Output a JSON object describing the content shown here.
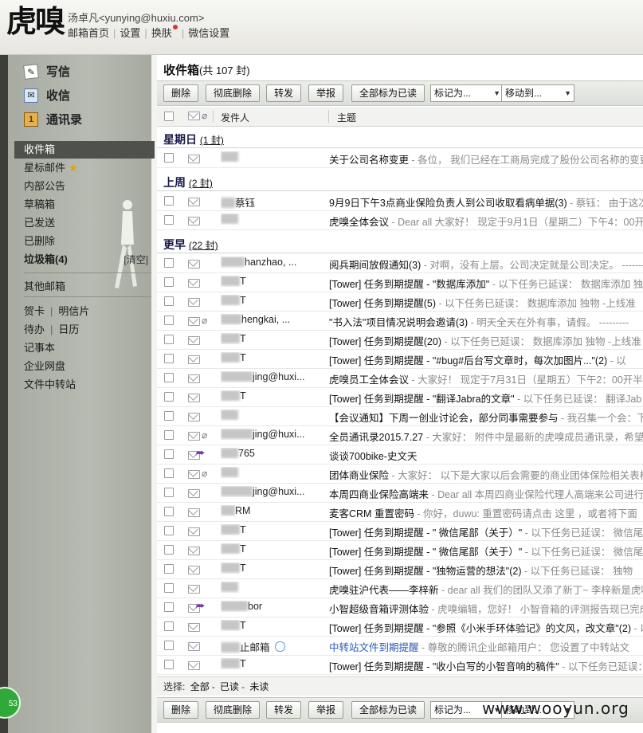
{
  "header": {
    "logo": "虎嗅",
    "user": "汤卓凡<yunying@huxiu.com>",
    "nav": [
      "邮箱首页",
      "设置",
      "换肤",
      "微信设置"
    ]
  },
  "sidebar": {
    "compose": "写信",
    "receive": "收信",
    "contacts": "通讯录",
    "folders": [
      "收件箱",
      "星标邮件",
      "内部公告",
      "草稿箱",
      "已发送",
      "已删除"
    ],
    "spam": "垃圾箱(4)",
    "clear": "[清空]",
    "other": "其他邮箱",
    "card": "贺卡",
    "postcard": "明信片",
    "todo": "待办",
    "calendar": "日历",
    "notebook": "记事本",
    "netdisk": "企业网盘",
    "transfer": "文件中转站",
    "badge": "53"
  },
  "main": {
    "title": "收件箱",
    "count": "(共 107 封)",
    "toolbar": {
      "delete": "删除",
      "perm_delete": "彻底删除",
      "forward": "转发",
      "report": "举报",
      "mark_all_read": "全部标为已读",
      "mark_as": "标记为...",
      "move_to": "移动到..."
    },
    "columns": {
      "sender": "发件人",
      "subject": "主题"
    },
    "groups": [
      {
        "name": "星期日",
        "count": "(1 封)"
      },
      {
        "name": "上周",
        "count": "(2 封)"
      },
      {
        "name": "更早",
        "count": "(22 封)"
      }
    ],
    "rows": [
      {
        "sender": "",
        "subject": "关于公司名称变更",
        "preview": " - 各位， 我们已经在工商局完成了股份公司名称的变更，"
      },
      {
        "sender": "蔡钰",
        "subject": "9月9日下午3点商业保险负责人到公司收取看病单据(3)",
        "preview": " - 蔡钰： 由于这次"
      },
      {
        "sender": "",
        "subject": "虎嗅全体会议",
        "preview": " - Dear all 大家好！ 现定于9月1日（星期二）下午4：00开"
      },
      {
        "sender": "hanzhao, ...",
        "subject": "阅兵期间放假通知(3)",
        "preview": " - 对啊，没有上层。公司决定就是公司决定。 -------"
      },
      {
        "sender": "T",
        "subject": "[Tower] 任务到期提醒 - \"数据库添加\"",
        "preview": " - 以下任务已延误： 数据库添加 独"
      },
      {
        "sender": "T",
        "subject": "[Tower] 任务到期提醒(5)",
        "preview": " - 以下任务已延误： 数据库添加 独物 -上线准"
      },
      {
        "sender": "hengkai, ...",
        "subject": "\"书入法\"项目情况说明会邀请(3)",
        "preview": " - 明天全天在外有事，请假。 ---------"
      },
      {
        "sender": "T",
        "subject": "[Tower] 任务到期提醒(20)",
        "preview": " - 以下任务已延误： 数据库添加 独物 -上线准"
      },
      {
        "sender": "T",
        "subject": "[Tower] 任务到期提醒 - \"#bug#后台写文章时，每次加图片...\"(2)",
        "preview": " - 以"
      },
      {
        "sender": "jing@huxi...",
        "subject": "虎嗅员工全体会议",
        "preview": " - 大家好！ 现定于7月31日（星期五）下午2：00开半年"
      },
      {
        "sender": "T",
        "subject": "[Tower] 任务到期提醒 - \"翻译Jabra的文章\"",
        "preview": " - 以下任务已延误： 翻译Jab"
      },
      {
        "sender": "",
        "subject": "【会议通知】下周一创业讨论会，部分同事需要参与",
        "preview": " - 我召集一个会：下周"
      },
      {
        "sender": "jing@huxi...",
        "subject": "全员通讯录2015.7.27",
        "preview": " - 大家好： 附件中是最新的虎嗅成员通讯录，希望"
      },
      {
        "sender": "765",
        "subject": "谈谈700bike-史文天",
        "preview": ""
      },
      {
        "sender": "",
        "subject": "团体商业保险",
        "preview": " - 大家好： 以下是大家以后会需要的商业团体保险相关表格，"
      },
      {
        "sender": "jing@huxi...",
        "subject": "本周四商业保险高端来",
        "preview": " - Dear all 本周四商业保险代理人高端来公司进行"
      },
      {
        "sender": "RM",
        "subject": "麦客CRM 重置密码",
        "preview": " - 你好，duwu: 重置密码请点击 这里 ，或者将下面"
      },
      {
        "sender": "T",
        "subject": "[Tower] 任务到期提醒 - \" 微信尾部（关于）\"",
        "preview": " - 以下任务已延误： 微信尾"
      },
      {
        "sender": "T",
        "subject": "[Tower] 任务到期提醒 - \" 微信尾部（关于）\"",
        "preview": " - 以下任务已延误： 微信尾"
      },
      {
        "sender": "T",
        "subject": "[Tower] 任务到期提醒 - \"独物运营的想法\"(2)",
        "preview": " - 以下任务已延误： 独物"
      },
      {
        "sender": "",
        "subject": "虎嗅驻沪代表——李梓新",
        "preview": " - dear all 我们的团队又添了新丁~ 李梓新是虎嗅"
      },
      {
        "sender": "bor",
        "subject": "小智超级音箱评测体验",
        "preview": " - 虎嗅编辑，您好！ 小智音箱的评测报告现已完成，"
      },
      {
        "sender": "T",
        "subject": "[Tower] 任务到期提醒 - \"参照《小米手环体验记》的文风，改文章\"(2)",
        "preview": " - 以"
      },
      {
        "sender": "止邮箱",
        "subject": "中转站文件到期提醒",
        "preview": " - 尊敬的腾讯企业邮箱用户： 您设置了中转站文"
      },
      {
        "sender": "T",
        "subject": "[Tower] 任务到期提醒 - \"收小白写的小智音响的稿件\"",
        "preview": " - 以下任务已延误："
      }
    ],
    "select": {
      "label": "选择:",
      "all": "全部",
      "read": "已读",
      "unread": "未读"
    }
  },
  "watermark": "www.wooyun.org"
}
